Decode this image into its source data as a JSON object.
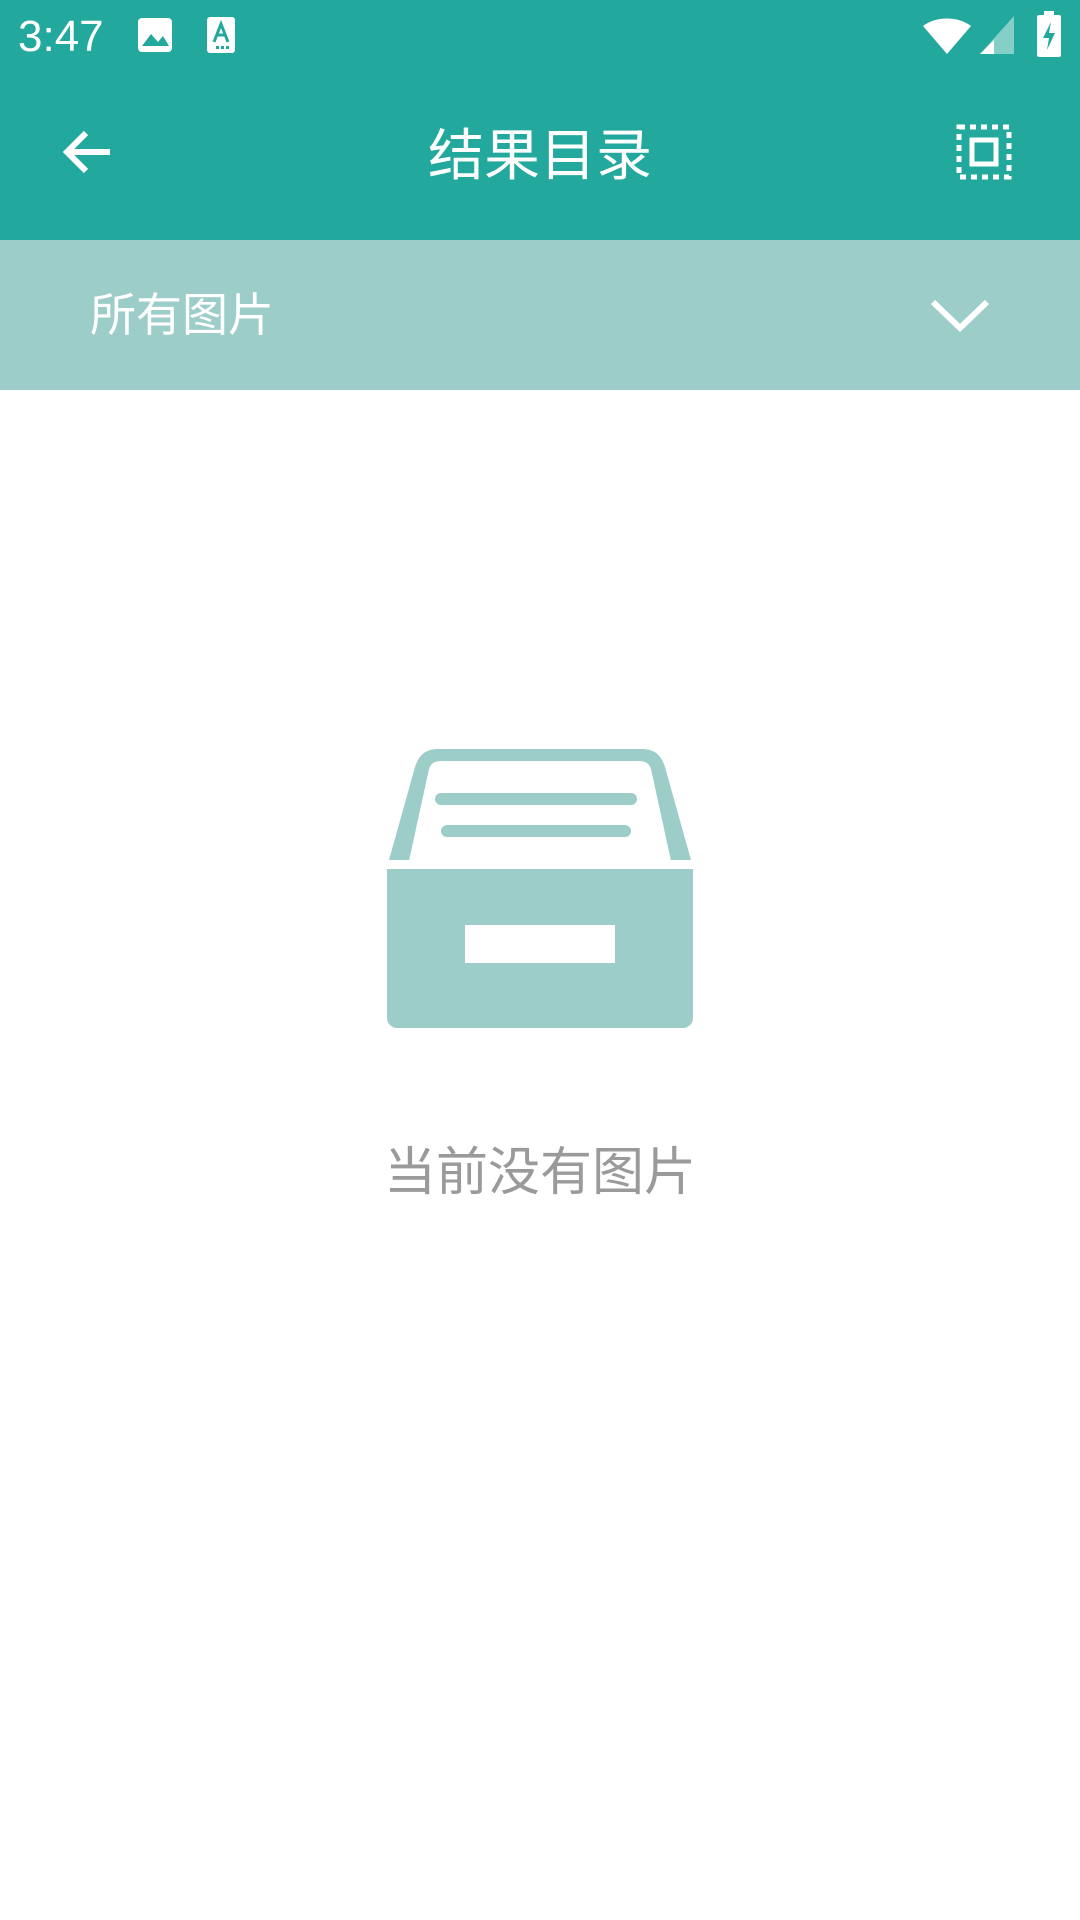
{
  "status_bar": {
    "time": "3:47",
    "icons": [
      "image-notification-icon",
      "text-notification-icon",
      "wifi-icon",
      "signal-icon",
      "battery-charging-icon"
    ]
  },
  "app_bar": {
    "title": "结果目录",
    "back_icon": "arrow-left-icon",
    "select_icon": "select-all-icon"
  },
  "filter": {
    "selected": "所有图片",
    "icon": "chevron-down-icon"
  },
  "empty_state": {
    "icon": "empty-drawer-icon",
    "message": "当前没有图片"
  },
  "colors": {
    "primary": "#22a89d",
    "filter_bar": "#9dcdc9",
    "illustration": "#9dcdc9",
    "empty_text": "#9a9a9a"
  }
}
